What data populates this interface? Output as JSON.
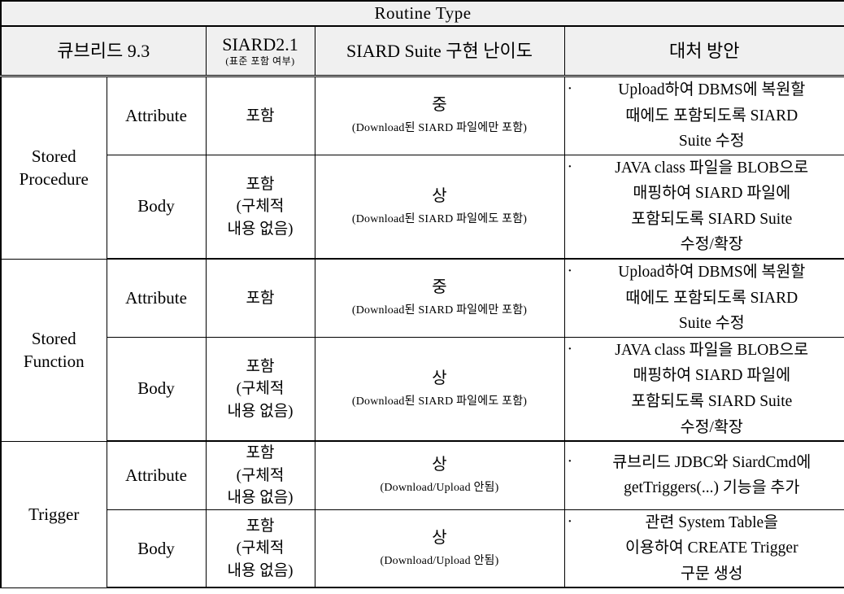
{
  "table": {
    "title": "Routine Type",
    "headers": {
      "cubrid": "큐브리드 9.3",
      "siard_main": "SIARD2.1",
      "siard_sub": "(표준 포함 여부)",
      "difficulty": "SIARD Suite 구현 난이도",
      "action": "대처 방안"
    },
    "groups": [
      {
        "name": "Stored\nProcedure",
        "name_lines": [
          "Stored",
          "Procedure"
        ],
        "rows": [
          {
            "part": "Attribute",
            "inclusion_lines": [
              "포함"
            ],
            "difficulty_level": "중",
            "difficulty_note": "(Download된 SIARD 파일에만 포함)",
            "action_lines": [
              "Upload하여 DBMS에 복원할",
              "때에도 포함되도록 SIARD",
              "Suite 수정"
            ]
          },
          {
            "part": "Body",
            "inclusion_lines": [
              "포함",
              "(구체적",
              "내용 없음)"
            ],
            "difficulty_level": "상",
            "difficulty_note": "(Download된 SIARD 파일에도 포함)",
            "action_lines": [
              "JAVA class 파일을 BLOB으로",
              "매핑하여 SIARD 파일에",
              "포함되도록 SIARD Suite",
              "수정/확장"
            ]
          }
        ]
      },
      {
        "name": "Stored\nFunction",
        "name_lines": [
          "Stored",
          "Function"
        ],
        "rows": [
          {
            "part": "Attribute",
            "inclusion_lines": [
              "포함"
            ],
            "difficulty_level": "중",
            "difficulty_note": "(Download된 SIARD 파일에만 포함)",
            "action_lines": [
              "Upload하여 DBMS에 복원할",
              "때에도 포함되도록 SIARD",
              "Suite 수정"
            ]
          },
          {
            "part": "Body",
            "inclusion_lines": [
              "포함",
              "(구체적",
              "내용 없음)"
            ],
            "difficulty_level": "상",
            "difficulty_note": "(Download된 SIARD 파일에도 포함)",
            "action_lines": [
              "JAVA class 파일을 BLOB으로",
              "매핑하여 SIARD 파일에",
              "포함되도록 SIARD Suite",
              "수정/확장"
            ]
          }
        ]
      },
      {
        "name": "Trigger",
        "name_lines": [
          "Trigger"
        ],
        "rows": [
          {
            "part": "Attribute",
            "inclusion_lines": [
              "포함",
              "(구체적",
              "내용 없음)"
            ],
            "difficulty_level": "상",
            "difficulty_note": "(Download/Upload 안됨)",
            "action_lines": [
              "큐브리드 JDBC와 SiardCmd에",
              "getTriggers(...) 기능을 추가"
            ]
          },
          {
            "part": "Body",
            "inclusion_lines": [
              "포함",
              "(구체적",
              "내용 없음)"
            ],
            "difficulty_level": "상",
            "difficulty_note": "(Download/Upload 안됨)",
            "action_lines": [
              "관련 System Table을",
              "이용하여 CREATE Trigger",
              "구문 생성"
            ]
          }
        ]
      }
    ]
  }
}
